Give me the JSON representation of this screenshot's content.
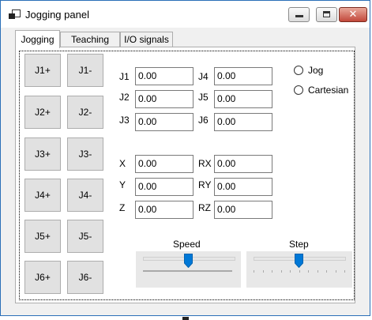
{
  "window": {
    "title": "Jogging panel"
  },
  "tabs": [
    "Jogging",
    "Teaching",
    "I/O signals"
  ],
  "jog_buttons": {
    "plus": [
      "J1+",
      "J2+",
      "J3+",
      "J4+",
      "J5+",
      "J6+"
    ],
    "minus": [
      "J1-",
      "J2-",
      "J3-",
      "J4-",
      "J5-",
      "J6-"
    ]
  },
  "joints": [
    {
      "label": "J1",
      "value": "0.00"
    },
    {
      "label": "J2",
      "value": "0.00"
    },
    {
      "label": "J3",
      "value": "0.00"
    },
    {
      "label": "J4",
      "value": "0.00"
    },
    {
      "label": "J5",
      "value": "0.00"
    },
    {
      "label": "J6",
      "value": "0.00"
    }
  ],
  "cartesian": [
    {
      "label": "X",
      "value": "0.00"
    },
    {
      "label": "Y",
      "value": "0.00"
    },
    {
      "label": "Z",
      "value": "0.00"
    },
    {
      "label": "RX",
      "value": "0.00"
    },
    {
      "label": "RY",
      "value": "0.00"
    },
    {
      "label": "RZ",
      "value": "0.00"
    }
  ],
  "mode": {
    "options": [
      "Jog",
      "Cartesian"
    ]
  },
  "speed": {
    "label": "Speed",
    "level": 0.5
  },
  "step": {
    "label": "Step",
    "level": 0.5
  },
  "colors": {
    "accent": "#0078d7",
    "close_button": "#c2473a"
  }
}
